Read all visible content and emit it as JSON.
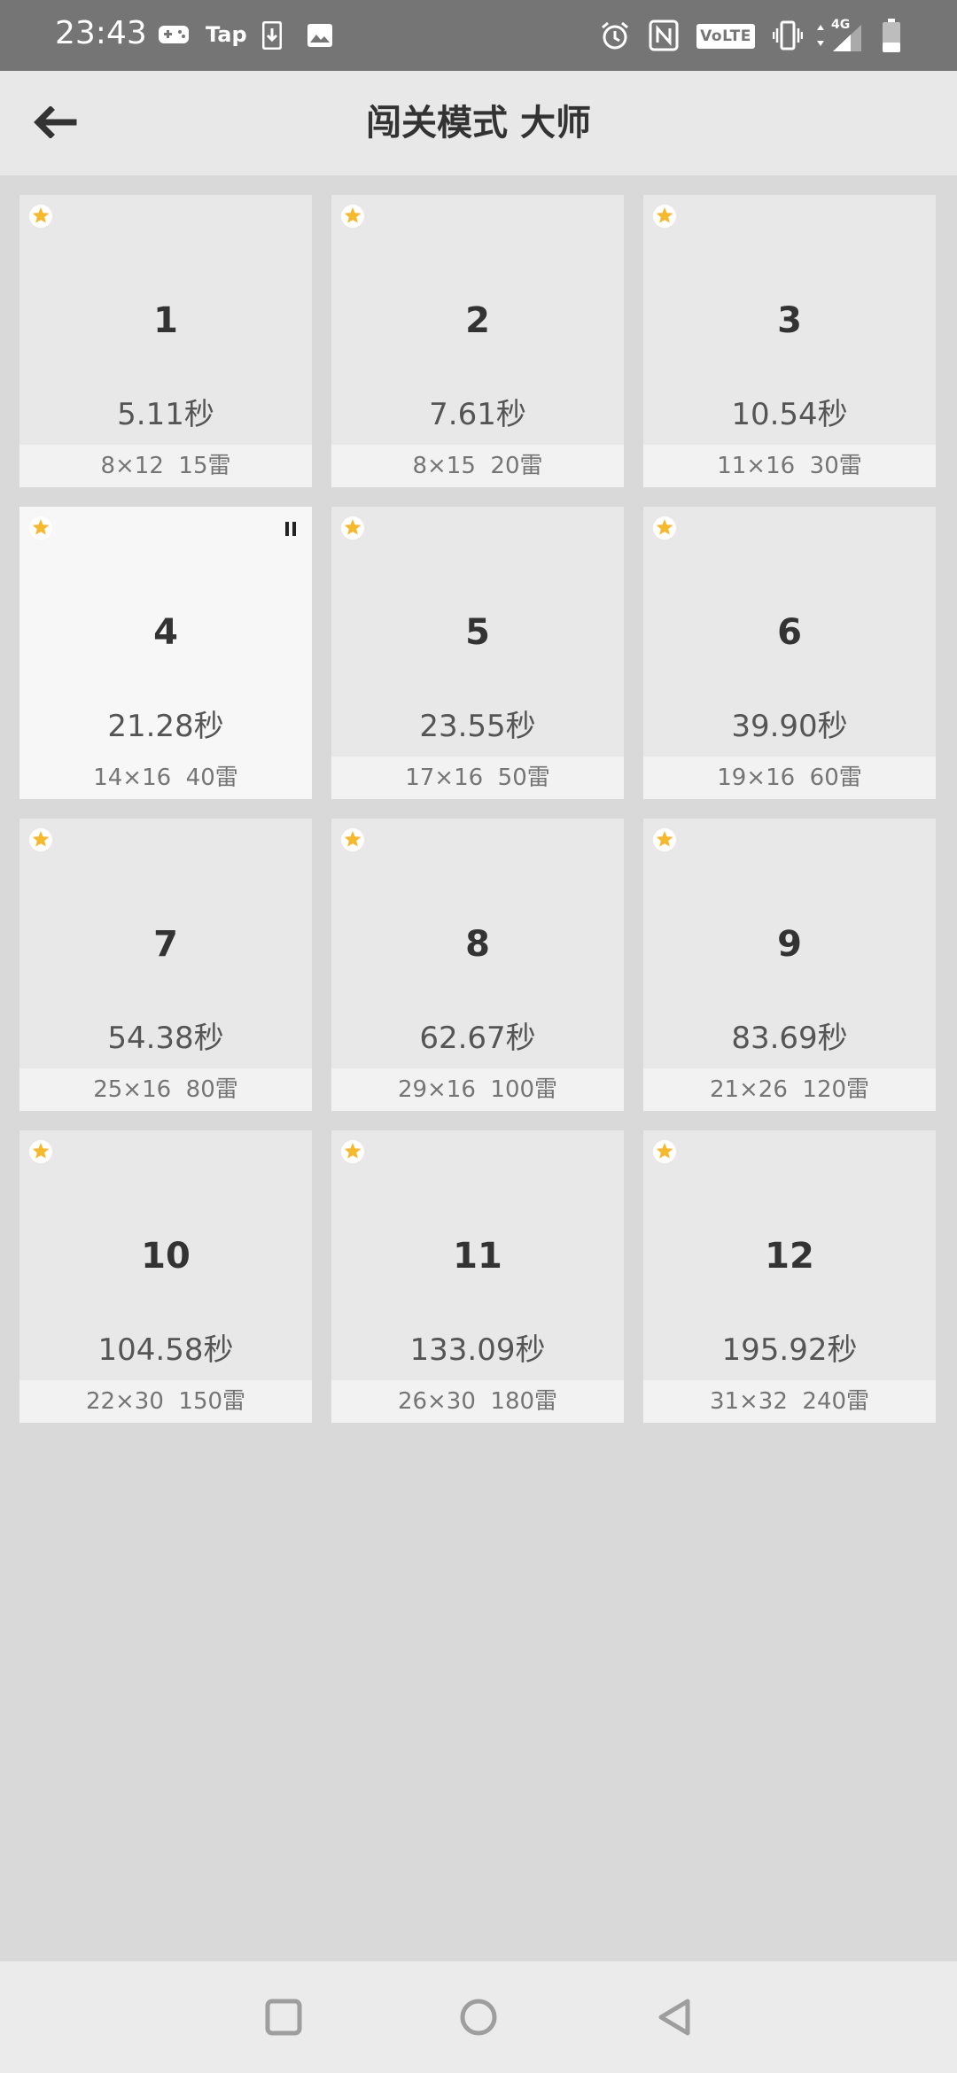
{
  "status_bar": {
    "time": "23:43",
    "left_icons": [
      "gamepad-icon",
      "tap-icon",
      "download-icon",
      "image-icon"
    ],
    "tap_label": "Tap",
    "volte_label": "VoLTE",
    "network_label": "4G",
    "right_icons": [
      "alarm-icon",
      "nfc-icon",
      "volte-icon",
      "vibrate-icon",
      "signal-icon",
      "battery-icon"
    ]
  },
  "header": {
    "title": "闯关模式 大师",
    "back_icon": "back-arrow-icon"
  },
  "levels": [
    {
      "number": "1",
      "time": "5.11秒",
      "info": "8×12  15雷",
      "starred": true
    },
    {
      "number": "2",
      "time": "7.61秒",
      "info": "8×15  20雷",
      "starred": true
    },
    {
      "number": "3",
      "time": "10.54秒",
      "info": "11×16  30雷",
      "starred": true
    },
    {
      "number": "4",
      "time": "21.28秒",
      "info": "14×16  40雷",
      "starred": true,
      "paused": true
    },
    {
      "number": "5",
      "time": "23.55秒",
      "info": "17×16  50雷",
      "starred": true
    },
    {
      "number": "6",
      "time": "39.90秒",
      "info": "19×16  60雷",
      "starred": true
    },
    {
      "number": "7",
      "time": "54.38秒",
      "info": "25×16  80雷",
      "starred": true
    },
    {
      "number": "8",
      "time": "62.67秒",
      "info": "29×16  100雷",
      "starred": true
    },
    {
      "number": "9",
      "time": "83.69秒",
      "info": "21×26  120雷",
      "starred": true
    },
    {
      "number": "10",
      "time": "104.58秒",
      "info": "22×30  150雷",
      "starred": true
    },
    {
      "number": "11",
      "time": "133.09秒",
      "info": "26×30  180雷",
      "starred": true
    },
    {
      "number": "12",
      "time": "195.92秒",
      "info": "31×32  240雷",
      "starred": true
    }
  ],
  "nav_bar": {
    "buttons": [
      "recents-square-icon",
      "home-circle-icon",
      "back-triangle-icon"
    ]
  },
  "colors": {
    "star": "#f5b82e",
    "status_bar": "#757575",
    "app_bar": "#e8e8e8",
    "background": "#d9d9d9",
    "tile": "#e8e8e8",
    "tile_active": "#f7f7f7"
  }
}
